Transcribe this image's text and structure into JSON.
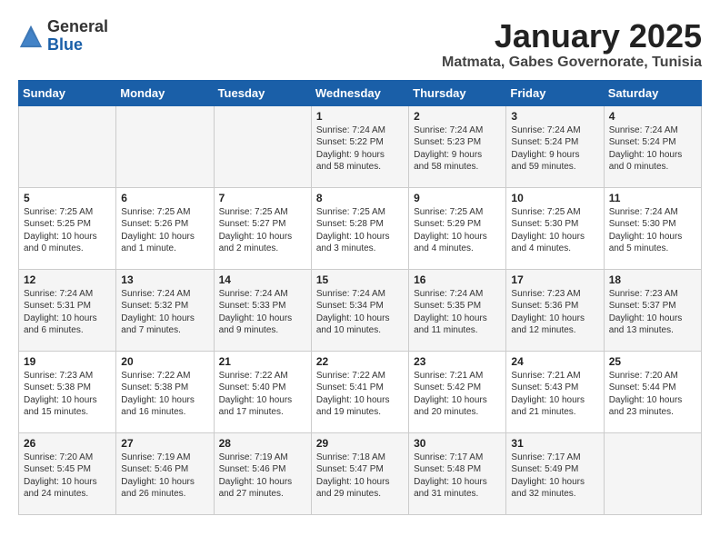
{
  "logo": {
    "general": "General",
    "blue": "Blue"
  },
  "header": {
    "title": "January 2025",
    "location": "Matmata, Gabes Governorate, Tunisia"
  },
  "days_of_week": [
    "Sunday",
    "Monday",
    "Tuesday",
    "Wednesday",
    "Thursday",
    "Friday",
    "Saturday"
  ],
  "weeks": [
    [
      {
        "day": "",
        "content": ""
      },
      {
        "day": "",
        "content": ""
      },
      {
        "day": "",
        "content": ""
      },
      {
        "day": "1",
        "content": "Sunrise: 7:24 AM\nSunset: 5:22 PM\nDaylight: 9 hours\nand 58 minutes."
      },
      {
        "day": "2",
        "content": "Sunrise: 7:24 AM\nSunset: 5:23 PM\nDaylight: 9 hours\nand 58 minutes."
      },
      {
        "day": "3",
        "content": "Sunrise: 7:24 AM\nSunset: 5:24 PM\nDaylight: 9 hours\nand 59 minutes."
      },
      {
        "day": "4",
        "content": "Sunrise: 7:24 AM\nSunset: 5:24 PM\nDaylight: 10 hours\nand 0 minutes."
      }
    ],
    [
      {
        "day": "5",
        "content": "Sunrise: 7:25 AM\nSunset: 5:25 PM\nDaylight: 10 hours\nand 0 minutes."
      },
      {
        "day": "6",
        "content": "Sunrise: 7:25 AM\nSunset: 5:26 PM\nDaylight: 10 hours\nand 1 minute."
      },
      {
        "day": "7",
        "content": "Sunrise: 7:25 AM\nSunset: 5:27 PM\nDaylight: 10 hours\nand 2 minutes."
      },
      {
        "day": "8",
        "content": "Sunrise: 7:25 AM\nSunset: 5:28 PM\nDaylight: 10 hours\nand 3 minutes."
      },
      {
        "day": "9",
        "content": "Sunrise: 7:25 AM\nSunset: 5:29 PM\nDaylight: 10 hours\nand 4 minutes."
      },
      {
        "day": "10",
        "content": "Sunrise: 7:25 AM\nSunset: 5:30 PM\nDaylight: 10 hours\nand 4 minutes."
      },
      {
        "day": "11",
        "content": "Sunrise: 7:24 AM\nSunset: 5:30 PM\nDaylight: 10 hours\nand 5 minutes."
      }
    ],
    [
      {
        "day": "12",
        "content": "Sunrise: 7:24 AM\nSunset: 5:31 PM\nDaylight: 10 hours\nand 6 minutes."
      },
      {
        "day": "13",
        "content": "Sunrise: 7:24 AM\nSunset: 5:32 PM\nDaylight: 10 hours\nand 7 minutes."
      },
      {
        "day": "14",
        "content": "Sunrise: 7:24 AM\nSunset: 5:33 PM\nDaylight: 10 hours\nand 9 minutes."
      },
      {
        "day": "15",
        "content": "Sunrise: 7:24 AM\nSunset: 5:34 PM\nDaylight: 10 hours\nand 10 minutes."
      },
      {
        "day": "16",
        "content": "Sunrise: 7:24 AM\nSunset: 5:35 PM\nDaylight: 10 hours\nand 11 minutes."
      },
      {
        "day": "17",
        "content": "Sunrise: 7:23 AM\nSunset: 5:36 PM\nDaylight: 10 hours\nand 12 minutes."
      },
      {
        "day": "18",
        "content": "Sunrise: 7:23 AM\nSunset: 5:37 PM\nDaylight: 10 hours\nand 13 minutes."
      }
    ],
    [
      {
        "day": "19",
        "content": "Sunrise: 7:23 AM\nSunset: 5:38 PM\nDaylight: 10 hours\nand 15 minutes."
      },
      {
        "day": "20",
        "content": "Sunrise: 7:22 AM\nSunset: 5:38 PM\nDaylight: 10 hours\nand 16 minutes."
      },
      {
        "day": "21",
        "content": "Sunrise: 7:22 AM\nSunset: 5:40 PM\nDaylight: 10 hours\nand 17 minutes."
      },
      {
        "day": "22",
        "content": "Sunrise: 7:22 AM\nSunset: 5:41 PM\nDaylight: 10 hours\nand 19 minutes."
      },
      {
        "day": "23",
        "content": "Sunrise: 7:21 AM\nSunset: 5:42 PM\nDaylight: 10 hours\nand 20 minutes."
      },
      {
        "day": "24",
        "content": "Sunrise: 7:21 AM\nSunset: 5:43 PM\nDaylight: 10 hours\nand 21 minutes."
      },
      {
        "day": "25",
        "content": "Sunrise: 7:20 AM\nSunset: 5:44 PM\nDaylight: 10 hours\nand 23 minutes."
      }
    ],
    [
      {
        "day": "26",
        "content": "Sunrise: 7:20 AM\nSunset: 5:45 PM\nDaylight: 10 hours\nand 24 minutes."
      },
      {
        "day": "27",
        "content": "Sunrise: 7:19 AM\nSunset: 5:46 PM\nDaylight: 10 hours\nand 26 minutes."
      },
      {
        "day": "28",
        "content": "Sunrise: 7:19 AM\nSunset: 5:46 PM\nDaylight: 10 hours\nand 27 minutes."
      },
      {
        "day": "29",
        "content": "Sunrise: 7:18 AM\nSunset: 5:47 PM\nDaylight: 10 hours\nand 29 minutes."
      },
      {
        "day": "30",
        "content": "Sunrise: 7:17 AM\nSunset: 5:48 PM\nDaylight: 10 hours\nand 31 minutes."
      },
      {
        "day": "31",
        "content": "Sunrise: 7:17 AM\nSunset: 5:49 PM\nDaylight: 10 hours\nand 32 minutes."
      },
      {
        "day": "",
        "content": ""
      }
    ]
  ]
}
